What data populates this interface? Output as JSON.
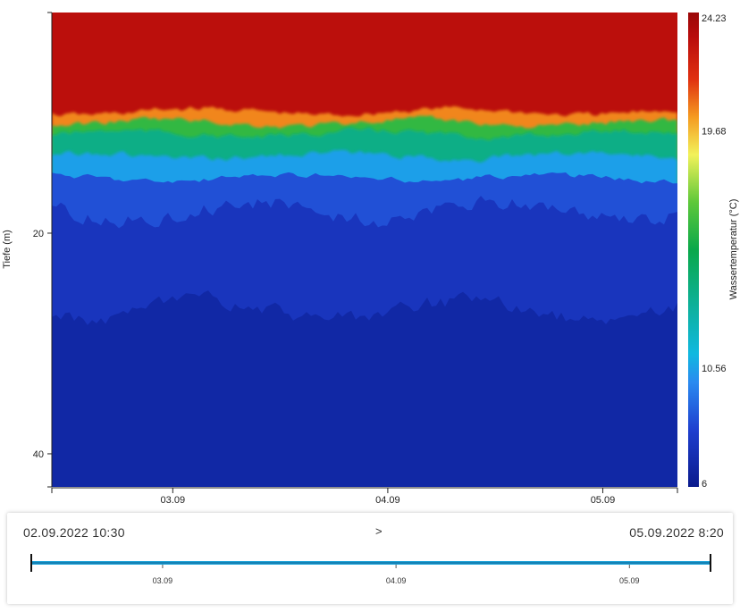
{
  "chart_data": {
    "type": "heatmap",
    "title": "",
    "xlabel": "",
    "ylabel": "Tiefe (m)",
    "x_ticks": [
      "03.09",
      "04.09",
      "05.09"
    ],
    "y_ticks": [
      20,
      40
    ],
    "y_range": [
      0,
      43
    ],
    "y_inverted": true,
    "x_range": [
      "02.09.2022 10:30",
      "05.09.2022 8:20"
    ],
    "colorbar": {
      "label": "Wassertemperatur (°C)",
      "min": 6,
      "max": 24.23,
      "tick_labels": [
        "24.23",
        "19.68",
        "10.56",
        "6"
      ],
      "tick_values": [
        24.23,
        19.68,
        10.56,
        6
      ],
      "colors": [
        "#0a1a8c",
        "#1e3fcf",
        "#2a8af0",
        "#10b8e0",
        "#0aa84a",
        "#2ec23a",
        "#f2f25a",
        "#f59a20",
        "#e03010",
        "#cc1010",
        "#9a0808"
      ]
    },
    "layers": [
      {
        "depth_from": 0,
        "depth_to": 9,
        "temperature": 23.2
      },
      {
        "depth_from": 9,
        "depth_to": 10,
        "temperature": 20.5
      },
      {
        "depth_from": 10,
        "depth_to": 11,
        "temperature": 16
      },
      {
        "depth_from": 11,
        "depth_to": 13,
        "temperature": 13.5
      },
      {
        "depth_from": 13,
        "depth_to": 15,
        "temperature": 10.5
      },
      {
        "depth_from": 15,
        "depth_to": 18,
        "temperature": 8.6
      },
      {
        "depth_from": 18,
        "depth_to": 27,
        "temperature": 7.6
      },
      {
        "depth_from": 27,
        "depth_to": 43,
        "temperature": 6.8
      }
    ]
  },
  "range_selector": {
    "start": "02.09.2022  10:30",
    "separator": ">",
    "end": "05.09.2022  8:20",
    "ticks": [
      "03.09",
      "04.09",
      "05.09"
    ]
  }
}
